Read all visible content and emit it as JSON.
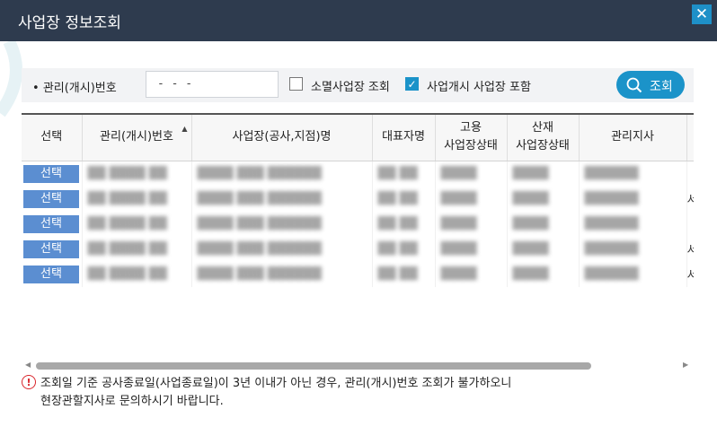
{
  "window": {
    "title": "사업장 정보조회",
    "close_glyph": "✕"
  },
  "search": {
    "mgmt_label": "관리(개시)번호",
    "mgmt_value": "- -   -",
    "option_closed": {
      "label": "소멸사업장 조회",
      "checked": false
    },
    "option_open": {
      "label": "사업개시 사업장 포함",
      "checked": true
    },
    "search_button": "조회"
  },
  "table": {
    "headers": {
      "select": "선택",
      "mgmt_no": "관리(개시)번호",
      "name": "사업장(공사,지점)명",
      "rep": "대표자명",
      "emp_line1": "고용",
      "emp_line2": "사업장상태",
      "ind_line1": "산재",
      "ind_line2": "사업장상태",
      "branch": "관리지사"
    },
    "select_label": "선택",
    "row_count": 5,
    "overflow_chars": [
      "",
      "서",
      "",
      "서",
      "서"
    ]
  },
  "notice": {
    "line1": "조회일 기준 공사종료일(사업종료일)이 3년 이내가 아닌 경우, 관리(개시)번호 조회가 불가하오니",
    "line2": "현장관할지사로 문의하시기 바랍니다."
  },
  "colors": {
    "titlebar": "#2e3b4e",
    "accent": "#1b93c9",
    "select_button": "#5b8ed1",
    "notice_red": "#d9262c"
  }
}
